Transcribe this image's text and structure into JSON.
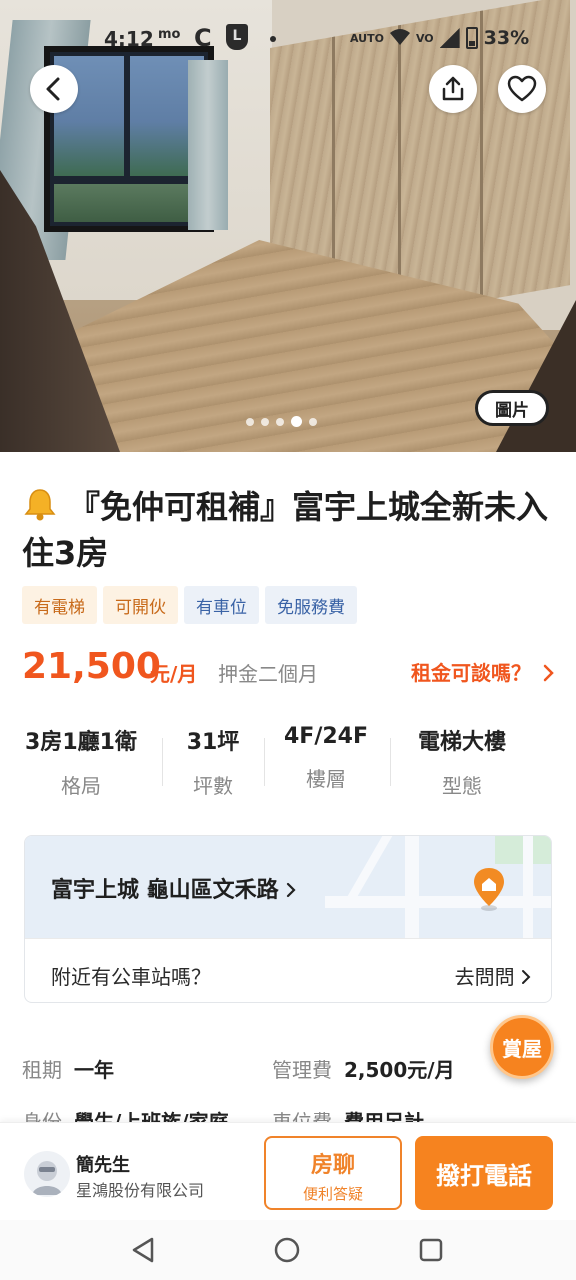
{
  "status_bar": {
    "time": "4:12",
    "mo": "mo",
    "c_icon": "C",
    "l_icon": "L",
    "signal_labels": [
      "AUTO",
      "VO"
    ],
    "battery": "33%"
  },
  "hero": {
    "photo_tag": "圖片",
    "carousel_count": 5,
    "carousel_active_index": 3
  },
  "listing": {
    "title": "『免仲可租補』富宇上城全新未入住3房",
    "tags": [
      "有電梯",
      "可開伙",
      "有車位",
      "免服務費"
    ],
    "price": "21,500",
    "price_unit": "元/月",
    "deposit": "押金二個月",
    "negotiate": "租金可談嗎？",
    "specs": [
      {
        "value": "3房1廳1衛",
        "label": "格局"
      },
      {
        "value": "31坪",
        "label": "坪數"
      },
      {
        "value": "4F/24F",
        "label": "樓層"
      },
      {
        "value": "電梯大樓",
        "label": "型態"
      }
    ]
  },
  "location": {
    "address": "富宇上城 龜山區文禾路",
    "bus_question": "附近有公車站嗎？",
    "ask": "去問問"
  },
  "details": {
    "lease_label": "租期",
    "lease_value": "一年",
    "fee_label": "管理費",
    "fee_value": "2,500元/月",
    "identity_label": "身份",
    "identity_value": "學生/上班族/家庭",
    "parking_label": "車位費",
    "parking_value": "費用另計"
  },
  "floating": {
    "label": "賞屋"
  },
  "agent": {
    "name": "簡先生",
    "company": "星鴻股份有限公司"
  },
  "actions": {
    "chat_title": "房聊",
    "chat_sub": "便利答疑",
    "call": "撥打電話"
  },
  "colors": {
    "accent_orange": "#f0561e",
    "button_orange": "#f6831f",
    "tag_warm_bg": "#fdf2e3",
    "tag_cool_bg": "#ecf1f8"
  },
  "icons": [
    "back-icon",
    "share-icon",
    "heart-icon",
    "bell-icon",
    "chevron-right-icon",
    "map-pin-icon",
    "nav-back-icon",
    "nav-home-icon",
    "nav-recents-icon"
  ]
}
